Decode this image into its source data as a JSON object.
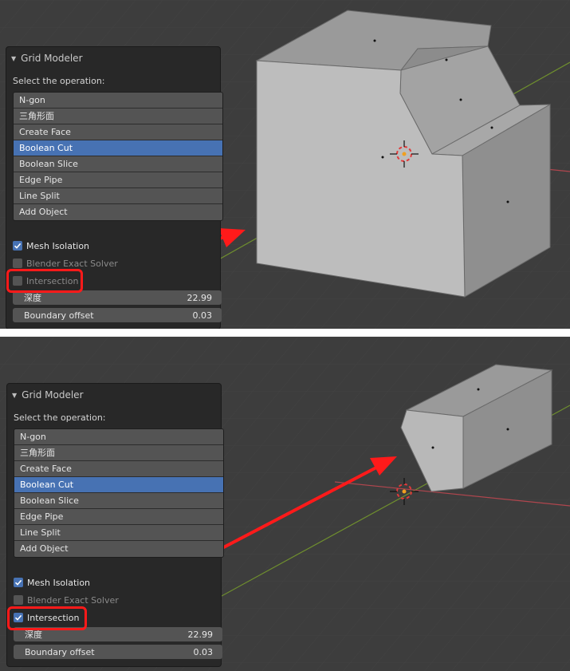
{
  "panels": [
    {
      "title": "Grid Modeler",
      "select_label": "Select the operation:",
      "operations": [
        "N-gon",
        "三角形面",
        "Create Face",
        "Boolean Cut",
        "Boolean Slice",
        "Edge Pipe",
        "Line Split",
        "Add Object"
      ],
      "selected_operation": "Boolean Cut",
      "options": [
        {
          "label": "Mesh Isolation",
          "checked": true
        },
        {
          "label": "Blender Exact Solver",
          "checked": false
        },
        {
          "label": "Intersection",
          "checked": false
        }
      ],
      "fields": [
        {
          "label": "深度",
          "value": "22.99"
        },
        {
          "label": "Boundary offset",
          "value": "0.03"
        }
      ]
    },
    {
      "title": "Grid Modeler",
      "select_label": "Select the operation:",
      "operations": [
        "N-gon",
        "三角形面",
        "Create Face",
        "Boolean Cut",
        "Boolean Slice",
        "Edge Pipe",
        "Line Split",
        "Add Object"
      ],
      "selected_operation": "Boolean Cut",
      "options": [
        {
          "label": "Mesh Isolation",
          "checked": true
        },
        {
          "label": "Blender Exact Solver",
          "checked": false
        },
        {
          "label": "Intersection",
          "checked": true
        }
      ],
      "fields": [
        {
          "label": "深度",
          "value": "22.99"
        },
        {
          "label": "Boundary offset",
          "value": "0.03"
        }
      ]
    }
  ],
  "colors": {
    "viewport_bg": "#3d3d3d",
    "selected_accent": "#4772b3",
    "annotation_red": "#ff1a1a",
    "x_axis": "#b0464e",
    "y_axis": "#6f8f2e"
  }
}
